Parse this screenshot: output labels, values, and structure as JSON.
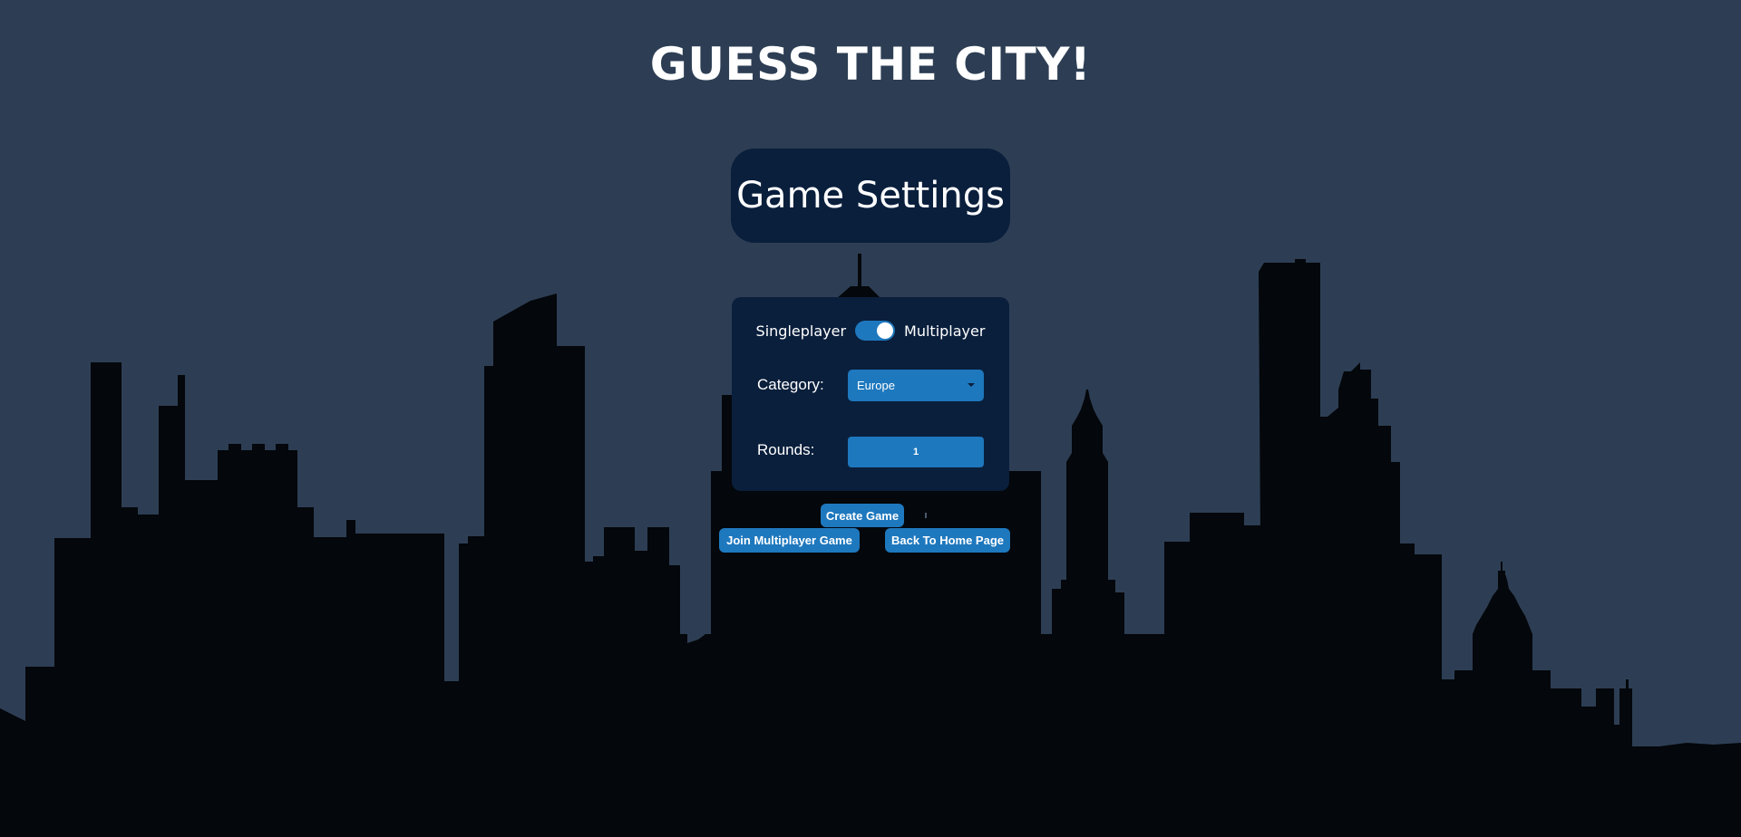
{
  "app": {
    "title": "GUESS THE CITY!"
  },
  "settings": {
    "header": "Game Settings",
    "mode": {
      "left_label": "Singleplayer",
      "right_label": "Multiplayer",
      "multiplayer_enabled": true
    },
    "category": {
      "label": "Category:",
      "value": "Europe"
    },
    "rounds": {
      "label": "Rounds:",
      "value": "1"
    }
  },
  "actions": {
    "create_game": "Create Game",
    "join_multiplayer": "Join Multiplayer Game",
    "back_home": "Back To Home Page"
  },
  "colors": {
    "background": "#2d3e54",
    "panel": "#0a1f3c",
    "accent": "#1e78be",
    "skyline": "#04070b"
  }
}
